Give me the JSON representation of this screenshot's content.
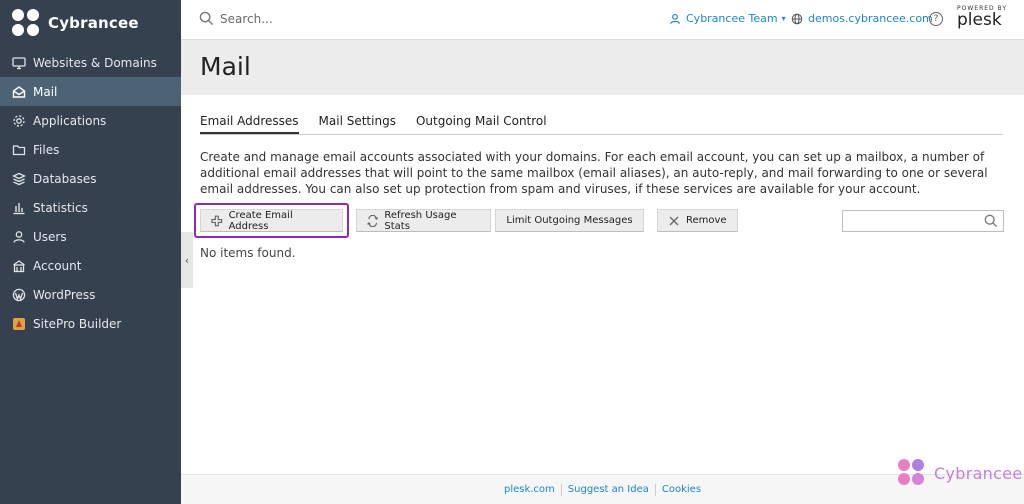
{
  "brand": {
    "name": "Cybrancee"
  },
  "sidebar": {
    "items": [
      {
        "label": "Websites & Domains",
        "icon": "monitor-icon",
        "active": false
      },
      {
        "label": "Mail",
        "icon": "mail-icon",
        "active": true
      },
      {
        "label": "Applications",
        "icon": "gear-icon",
        "active": false
      },
      {
        "label": "Files",
        "icon": "folder-icon",
        "active": false
      },
      {
        "label": "Databases",
        "icon": "database-icon",
        "active": false
      },
      {
        "label": "Statistics",
        "icon": "bar-chart-icon",
        "active": false
      },
      {
        "label": "Users",
        "icon": "user-icon",
        "active": false
      },
      {
        "label": "Account",
        "icon": "account-icon",
        "active": false
      },
      {
        "label": "WordPress",
        "icon": "wordpress-icon",
        "active": false
      },
      {
        "label": "SitePro Builder",
        "icon": "sitepro-icon",
        "active": false
      }
    ]
  },
  "header": {
    "search_placeholder": "Search...",
    "team": "Cybrancee Team",
    "domain": "demos.cybrancee.com",
    "help": "?",
    "powered_by": "POWERED BY",
    "plesk": "plesk"
  },
  "page": {
    "title": "Mail"
  },
  "tabs": [
    {
      "label": "Email Addresses",
      "active": true
    },
    {
      "label": "Mail Settings",
      "active": false
    },
    {
      "label": "Outgoing Mail Control",
      "active": false
    }
  ],
  "description": "Create and manage email accounts associated with your domains. For each email account, you can set up a mailbox, a number of additional email addresses that will point to the same mailbox (email aliases), an auto-reply, and mail forwarding to one or several email addresses. You can also set up protection from spam and viruses, if these services are available for your account.",
  "toolbar": {
    "create": "Create Email Address",
    "refresh": "Refresh Usage Stats",
    "limit": "Limit Outgoing Messages",
    "remove": "Remove",
    "filter_value": ""
  },
  "list": {
    "empty_text": "No items found."
  },
  "footer": {
    "links": [
      "plesk.com",
      "Suggest an Idea",
      "Cookies"
    ]
  },
  "watermark": {
    "text": "Cybrancee"
  },
  "colors": {
    "sidebar_bg": "#35414f",
    "sidebar_active": "#4c6275",
    "link": "#1b86c9",
    "highlight": "#8b2bb5"
  }
}
